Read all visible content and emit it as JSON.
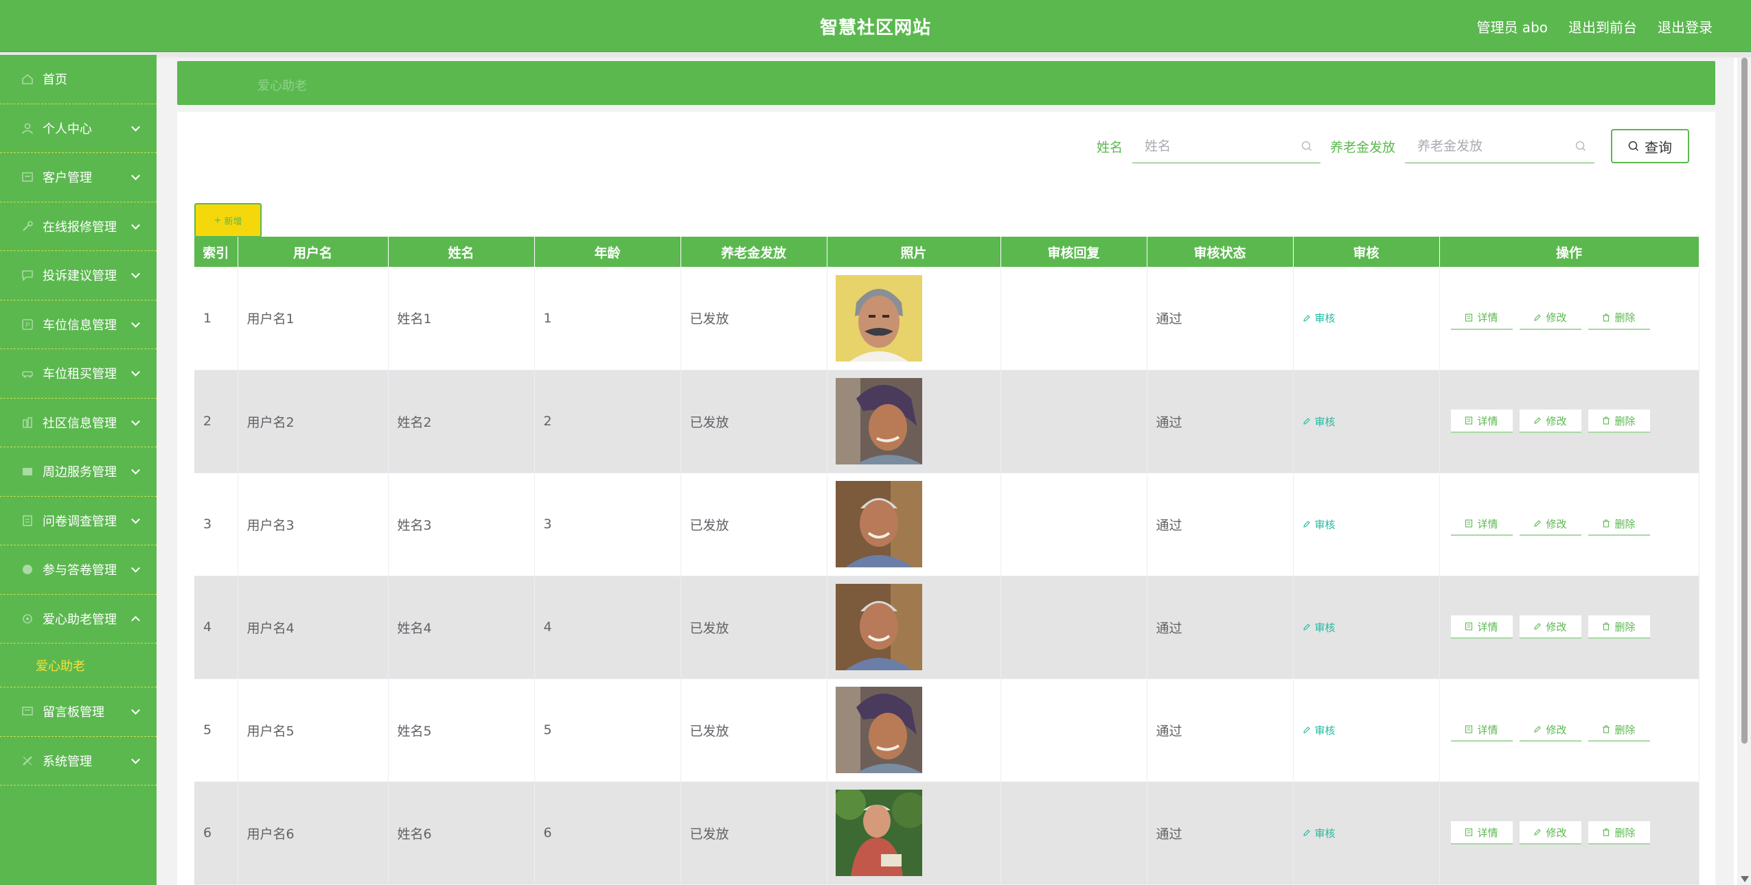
{
  "header": {
    "title": "智慧社区网站",
    "admin": "管理员 abo",
    "front": "退出到前台",
    "logout": "退出登录"
  },
  "sidebar": {
    "items": [
      {
        "label": "首页",
        "icon": "home-icon",
        "chevron": false
      },
      {
        "label": "个人中心",
        "icon": "user-icon",
        "chevron": true
      },
      {
        "label": "客户管理",
        "icon": "customer-icon",
        "chevron": true
      },
      {
        "label": "在线报修管理",
        "icon": "repair-icon",
        "chevron": true
      },
      {
        "label": "投诉建议管理",
        "icon": "complaint-icon",
        "chevron": true
      },
      {
        "label": "车位信息管理",
        "icon": "parking-icon",
        "chevron": true
      },
      {
        "label": "车位租买管理",
        "icon": "car-rent-icon",
        "chevron": true
      },
      {
        "label": "社区信息管理",
        "icon": "community-icon",
        "chevron": true
      },
      {
        "label": "周边服务管理",
        "icon": "service-icon",
        "chevron": true
      },
      {
        "label": "问卷调查管理",
        "icon": "survey-icon",
        "chevron": true
      },
      {
        "label": "参与答卷管理",
        "icon": "answer-icon",
        "chevron": true
      },
      {
        "label": "爱心助老管理",
        "icon": "heart-icon",
        "chevron": true,
        "expanded": true
      }
    ],
    "sub_item": "爱心助老",
    "tail_items": [
      {
        "label": "留言板管理",
        "icon": "message-icon",
        "chevron": true
      },
      {
        "label": "系统管理",
        "icon": "system-icon",
        "chevron": true
      }
    ]
  },
  "breadcrumb": "爱心助老",
  "search": {
    "name_label": "姓名",
    "name_placeholder": "姓名",
    "pension_label": "养老金发放",
    "pension_placeholder": "养老金发放",
    "query_label": "查询"
  },
  "add_label": "新增",
  "table": {
    "columns": [
      "索引",
      "用户名",
      "姓名",
      "年龄",
      "养老金发放",
      "照片",
      "审核回复",
      "审核状态",
      "审核",
      "操作"
    ],
    "rows": [
      {
        "index": "1",
        "username": "用户名1",
        "name": "姓名1",
        "age": "1",
        "pension": "已发放",
        "photo": "portrait-man-yellow",
        "reply": "",
        "status": "通过"
      },
      {
        "index": "2",
        "username": "用户名2",
        "name": "姓名2",
        "age": "2",
        "pension": "已发放",
        "photo": "portrait-woman-hat",
        "reply": "",
        "status": "通过"
      },
      {
        "index": "3",
        "username": "用户名3",
        "name": "姓名3",
        "age": "3",
        "pension": "已发放",
        "photo": "portrait-man-smile",
        "reply": "",
        "status": "通过"
      },
      {
        "index": "4",
        "username": "用户名4",
        "name": "姓名4",
        "age": "4",
        "pension": "已发放",
        "photo": "portrait-man-smile",
        "reply": "",
        "status": "通过"
      },
      {
        "index": "5",
        "username": "用户名5",
        "name": "姓名5",
        "age": "5",
        "pension": "已发放",
        "photo": "portrait-woman-hat",
        "reply": "",
        "status": "通过"
      },
      {
        "index": "6",
        "username": "用户名6",
        "name": "姓名6",
        "age": "6",
        "pension": "已发放",
        "photo": "portrait-man-garden",
        "reply": "",
        "status": "通过"
      }
    ],
    "audit_label": "审核",
    "detail_label": "详情",
    "edit_label": "修改",
    "delete_label": "删除"
  },
  "colors": {
    "primary": "#5bb84f",
    "accent_yellow": "#f5d80b",
    "audit_teal": "#21b9a0",
    "sub_active": "#f5e03a"
  }
}
